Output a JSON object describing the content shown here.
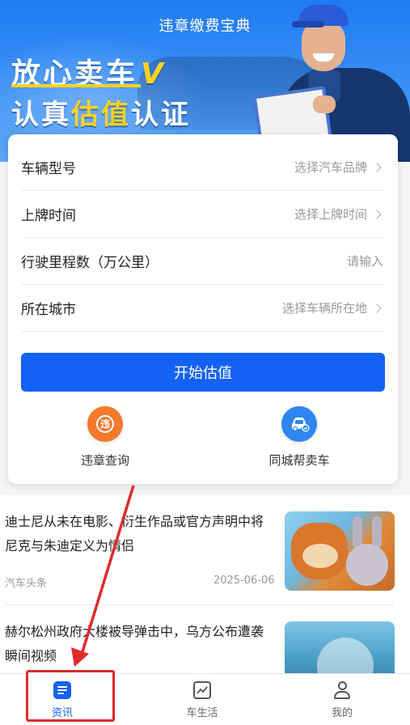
{
  "banner": {
    "app_title": "违章缴费宝典",
    "slogan_line1": "放心卖车",
    "slogan_line1_mark": "V",
    "slogan_line2_pre": "认真",
    "slogan_line2_highlight": "估值",
    "slogan_line2_post": "认证"
  },
  "form": {
    "rows": [
      {
        "label": "车辆型号",
        "value": "选择汽车品牌",
        "chevron": true
      },
      {
        "label": "上牌时间",
        "value": "选择上牌时间",
        "chevron": true
      },
      {
        "label": "行驶里程数（万公里）",
        "value": "请输入",
        "chevron": false
      },
      {
        "label": "所在城市",
        "value": "选择车辆所在地",
        "chevron": true
      }
    ],
    "submit_label": "开始估值"
  },
  "quick_actions": [
    {
      "label": "违章查询",
      "icon": "violation-query-icon",
      "glyph": "违",
      "color": "#f27a2a"
    },
    {
      "label": "同城帮卖车",
      "icon": "car-sell-icon",
      "glyph": "🚗",
      "color": "#2f86f0"
    }
  ],
  "news": [
    {
      "title": "迪士尼从未在电影、衍生作品或官方声明中将尼克与朱迪定义为情侣",
      "source": "汽车头条",
      "date": "2025-06-06"
    },
    {
      "title": "赫尔松州政府大楼被导弹击中，乌方公布遭袭瞬间视频",
      "source": "",
      "date": ""
    }
  ],
  "tabbar": {
    "tabs": [
      {
        "label": "资讯",
        "icon": "news-icon",
        "active": true
      },
      {
        "label": "车生活",
        "icon": "car-life-icon",
        "active": false
      },
      {
        "label": "我的",
        "icon": "profile-icon",
        "active": false
      }
    ]
  },
  "colors": {
    "primary": "#1462f5",
    "accent": "#ffd21e",
    "annotation": "#e12a2a"
  }
}
